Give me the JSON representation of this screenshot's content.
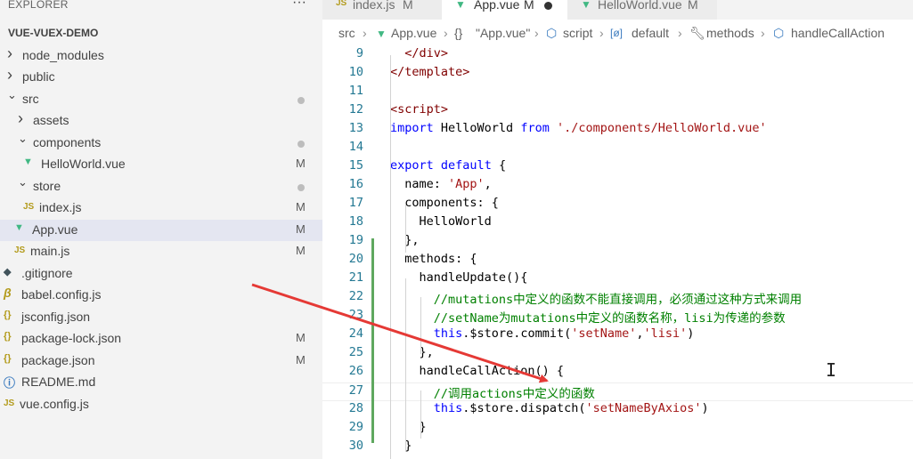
{
  "explorer": {
    "title": "EXPLORER",
    "more_icon": "ellipsis-icon",
    "root": "VUE-VUEX-DEMO",
    "items": [
      {
        "label": "node_modules",
        "type": "folder",
        "expanded": false,
        "status": ""
      },
      {
        "label": "public",
        "type": "folder",
        "expanded": false,
        "status": ""
      },
      {
        "label": "src",
        "type": "folder",
        "expanded": true,
        "status": "dot"
      },
      {
        "label": "assets",
        "type": "folder",
        "expanded": false,
        "status": ""
      },
      {
        "label": "components",
        "type": "folder",
        "expanded": true,
        "status": "dot"
      },
      {
        "label": "HelloWorld.vue",
        "type": "vue",
        "status": "M"
      },
      {
        "label": "store",
        "type": "folder",
        "expanded": true,
        "status": "dot"
      },
      {
        "label": "index.js",
        "type": "js",
        "status": "M"
      },
      {
        "label": "App.vue",
        "type": "vue",
        "status": "M",
        "selected": true
      },
      {
        "label": "main.js",
        "type": "js",
        "status": "M"
      },
      {
        "label": ".gitignore",
        "type": "git",
        "status": ""
      },
      {
        "label": "babel.config.js",
        "type": "babel",
        "status": ""
      },
      {
        "label": "jsconfig.json",
        "type": "json",
        "status": ""
      },
      {
        "label": "package-lock.json",
        "type": "json",
        "status": "M"
      },
      {
        "label": "package.json",
        "type": "json",
        "status": "M"
      },
      {
        "label": "README.md",
        "type": "info",
        "status": ""
      },
      {
        "label": "vue.config.js",
        "type": "js",
        "status": ""
      }
    ],
    "js_badge": "JS",
    "json_badge": "{}",
    "dot_color": "#bdbdbd"
  },
  "tabs": [
    {
      "label": "index.js",
      "modified": "M",
      "icon": "js-file-icon",
      "badge": "JS",
      "active": false
    },
    {
      "label": "App.vue",
      "modified": "M",
      "icon": "vue-file-icon",
      "active": true,
      "dirty": true
    },
    {
      "label": "HelloWorld.vue",
      "modified": "M",
      "icon": "vue-file-icon",
      "active": false
    }
  ],
  "breadcrumb": [
    "src",
    "App.vue",
    "\"App.vue\"",
    "script",
    "default",
    "methods",
    "handleCallAction"
  ],
  "breadcrumb_icons": {
    "json": "{}",
    "default": "[ø]"
  },
  "editor": {
    "lines": [
      {
        "n": "9",
        "tokens": [
          [
            "pun",
            "  "
          ],
          [
            "tag",
            "</div>"
          ]
        ]
      },
      {
        "n": "10",
        "tokens": [
          [
            "tag",
            "</template>"
          ]
        ]
      },
      {
        "n": "11",
        "tokens": []
      },
      {
        "n": "12",
        "tokens": [
          [
            "tag",
            "<script>"
          ]
        ]
      },
      {
        "n": "13",
        "tokens": [
          [
            "kw",
            "import"
          ],
          [
            "pun",
            " HelloWorld "
          ],
          [
            "kw",
            "from"
          ],
          [
            "pun",
            " "
          ],
          [
            "str",
            "'./components/HelloWorld.vue'"
          ]
        ]
      },
      {
        "n": "14",
        "tokens": []
      },
      {
        "n": "15",
        "tokens": [
          [
            "kw",
            "export"
          ],
          [
            "pun",
            " "
          ],
          [
            "kw",
            "default"
          ],
          [
            "pun",
            " {"
          ]
        ]
      },
      {
        "n": "16",
        "tokens": [
          [
            "pun",
            "  name: "
          ],
          [
            "str",
            "'App'"
          ],
          [
            "pun",
            ","
          ]
        ]
      },
      {
        "n": "17",
        "tokens": [
          [
            "pun",
            "  components: {"
          ]
        ]
      },
      {
        "n": "18",
        "tokens": [
          [
            "pun",
            "    HelloWorld"
          ]
        ]
      },
      {
        "n": "19",
        "tokens": [
          [
            "pun",
            "  },"
          ]
        ]
      },
      {
        "n": "20",
        "tokens": [
          [
            "pun",
            "  methods: {"
          ]
        ]
      },
      {
        "n": "21",
        "tokens": [
          [
            "pun",
            "    handleUpdate(){"
          ]
        ]
      },
      {
        "n": "22",
        "tokens": [
          [
            "pun",
            "      "
          ],
          [
            "cmt",
            "//mutations中定义的函数不能直接调用，必须通过这种方式来调用"
          ]
        ]
      },
      {
        "n": "23",
        "tokens": [
          [
            "pun",
            "      "
          ],
          [
            "cmt",
            "//setName为mutations中定义的函数名称，lisi为传递的参数"
          ]
        ]
      },
      {
        "n": "24",
        "tokens": [
          [
            "pun",
            "      "
          ],
          [
            "kw",
            "this"
          ],
          [
            "pun",
            ".$store.commit("
          ],
          [
            "str",
            "'setName'"
          ],
          [
            "pun",
            ","
          ],
          [
            "str",
            "'lisi'"
          ],
          [
            "pun",
            ")"
          ]
        ]
      },
      {
        "n": "25",
        "tokens": [
          [
            "pun",
            "    },"
          ]
        ]
      },
      {
        "n": "26",
        "tokens": [
          [
            "pun",
            "    handleCallAction() {"
          ]
        ]
      },
      {
        "n": "27",
        "tokens": [
          [
            "pun",
            "      "
          ],
          [
            "cmt",
            "//调用actions中定义的函数"
          ]
        ]
      },
      {
        "n": "28",
        "tokens": [
          [
            "pun",
            "      "
          ],
          [
            "kw",
            "this"
          ],
          [
            "pun",
            ".$store.dispatch("
          ],
          [
            "str",
            "'setNameByAxios'"
          ],
          [
            "pun",
            ")"
          ]
        ]
      },
      {
        "n": "29",
        "tokens": [
          [
            "pun",
            "    }"
          ]
        ]
      },
      {
        "n": "30",
        "tokens": [
          [
            "pun",
            "  }"
          ]
        ]
      }
    ],
    "current_line": "27",
    "modified_gutter_lines": [
      "19",
      "29"
    ],
    "cursor_glyph": "I"
  },
  "annotation": {
    "color": "#e53935"
  },
  "colors": {
    "accent": "#41b883",
    "modified_gutter": "#5fa85f",
    "arrow": "#e53935"
  }
}
